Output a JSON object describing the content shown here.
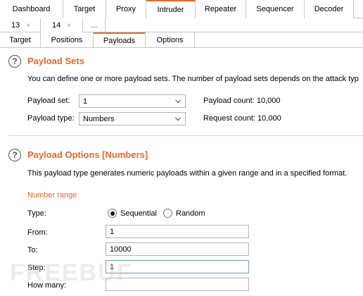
{
  "top_tabs": [
    "Dashboard",
    "Target",
    "Proxy",
    "Intruder",
    "Repeater",
    "Sequencer",
    "Decoder"
  ],
  "instance_tabs": [
    {
      "label": "13",
      "close": "×"
    },
    {
      "label": "14",
      "close": "×"
    },
    {
      "label": "..."
    }
  ],
  "sub_tabs": [
    "Target",
    "Positions",
    "Payloads",
    "Options"
  ],
  "payload_sets": {
    "help": "?",
    "title": "Payload Sets",
    "description": "You can define one or more payload sets. The number of payload sets depends on the attack typ",
    "set_label": "Payload set:",
    "set_value": "1",
    "type_label": "Payload type:",
    "type_value": "Numbers",
    "payload_count": "Payload count: 10,000",
    "request_count": "Request count: 10,000"
  },
  "payload_options": {
    "help": "?",
    "title": "Payload Options [Numbers]",
    "description": "This payload type generates numeric payloads within a given range and in a specified format.",
    "number_range": "Number range",
    "type_label": "Type:",
    "sequential": "Sequential",
    "random": "Random",
    "from_label": "From:",
    "from_value": "1",
    "to_label": "To:",
    "to_value": "10000",
    "step_label": "Step:",
    "step_value": "1",
    "howmany_label": "How many:",
    "howmany_value": ""
  },
  "watermark": "FREEBUF",
  "colors": {
    "accent": "#e8682a",
    "border": "#c8c8c8"
  }
}
